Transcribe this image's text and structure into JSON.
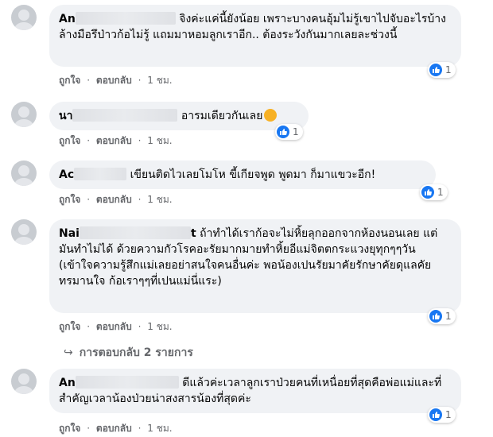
{
  "comments": [
    {
      "name_visible": "An",
      "text": "จิงค่ะแค่นี้ยังน้อย เพราะบางคนอุ้มไม่รู้เขาไปจับอะไรบ้างล้างมือรึป่าวก้อไม่รู้ แถมมาหอมลูกเราอีก.. ต้องระวังกันมากเลยละช่วงนี้",
      "like": "ถูกใจ",
      "reply": "ตอบกลับ",
      "time": "1 ชม.",
      "reactions": "1"
    },
    {
      "name_visible": "นา",
      "text": "อารมเดียวกันเลย",
      "like": "ถูกใจ",
      "reply": "ตอบกลับ",
      "time": "1 ชม.",
      "reactions": "1"
    },
    {
      "name_visible": "Ac",
      "text": "เขียนติดไวเลยโมโห ขี้เกียจพูด พูดมา ก็มาแขวะอีก!",
      "like": "ถูกใจ",
      "reply": "ตอบกลับ",
      "time": "1 ชม.",
      "reactions": "1"
    },
    {
      "name_visible": "Nai",
      "name_tail": "t",
      "text": "ถ้าทำได้เราก้อจะไม่หิ้ยลุกออกจากห้องนอนเลย แต่มันทำไม่ได้ ด้วยความกัวโรคอะรัยมากมายทำหิ้ยอีแม่จิตตกระแวงยุทุกๆๆวัน (เข้าใจความรู้สึกแม่เลยอย่าสนใจคนอื่นค่ะ พอน้องเปนรัยมาคัยรักษาคัยดุแลคัยทรมานใจ ก้อเราๆๆที่เปนแม่นี่แระ)",
      "like": "ถูกใจ",
      "reply": "ตอบกลับ",
      "time": "1 ชม.",
      "reactions": "1"
    },
    {
      "name_visible": "An",
      "text": "ดีแล้วค่ะเวลาลูกเราป่วยคนที่เหนื่อยที่สุดคือพ่อแม่และที่สำคัญเวลาน้องป่วยน่าสงสารน้องที่สุดค่ะ",
      "like": "ถูกใจ",
      "reply": "ตอบกลับ",
      "time": "1 ชม.",
      "reactions": "1"
    }
  ],
  "replies_link": "การตอบกลับ 2 รายการ",
  "separator": "·",
  "colors": {
    "like_blue": "#1877f2",
    "bubble": "#f0f2f5",
    "meta": "#65676b"
  }
}
